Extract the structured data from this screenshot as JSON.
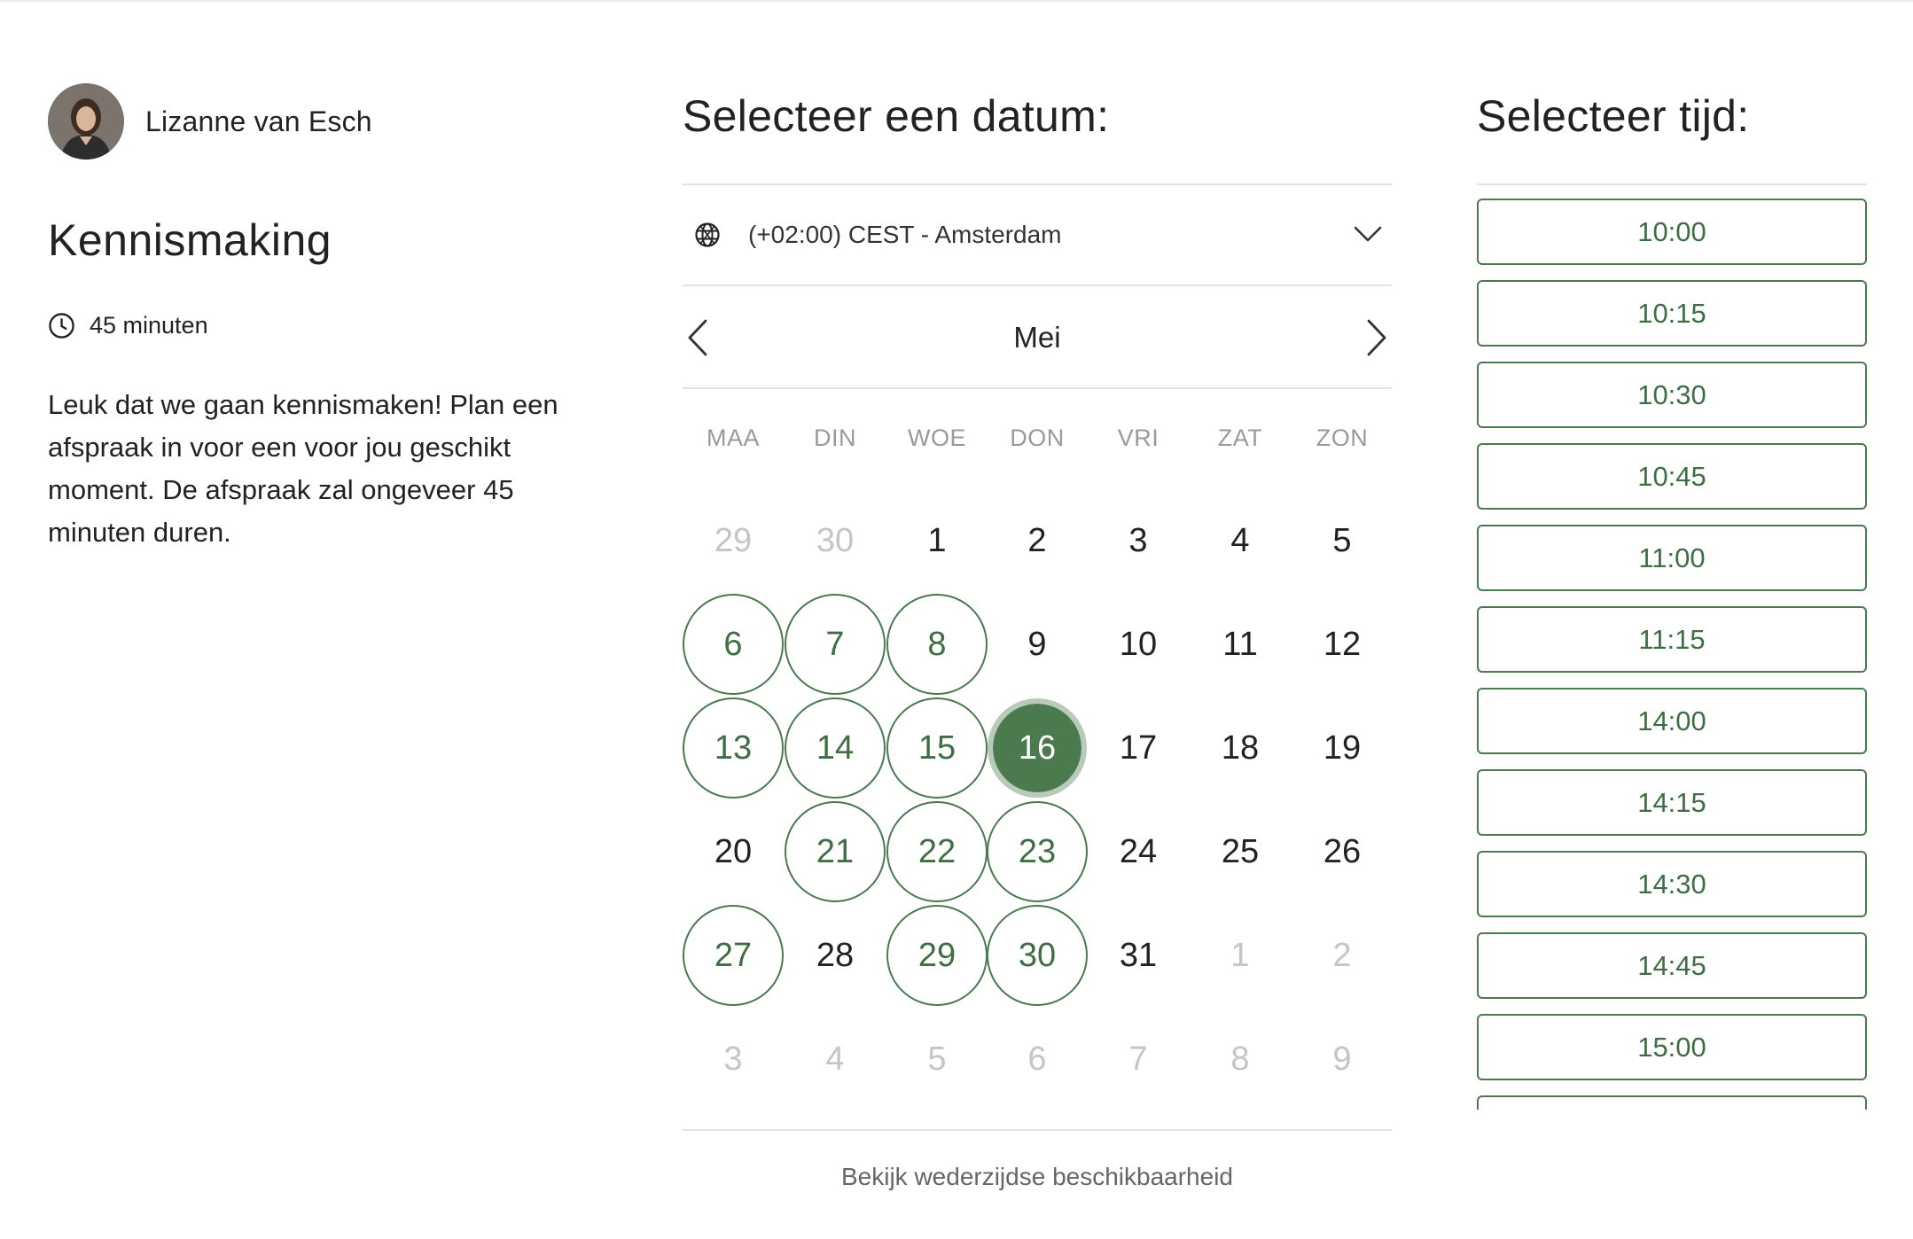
{
  "host": {
    "name": "Lizanne van Esch",
    "avatar_icon": "person-photo"
  },
  "event": {
    "title": "Kennismaking",
    "duration": "45 minuten",
    "description": "Leuk dat we gaan kennismaken! Plan een afspraak in voor een voor jou geschikt moment. De afspraak zal ongeveer 45 minuten duren."
  },
  "date_picker": {
    "heading": "Selecteer een datum:",
    "timezone": "(+02:00) CEST - Amsterdam",
    "month": "Mei",
    "weekdays": [
      "MAA",
      "DIN",
      "WOE",
      "DON",
      "VRI",
      "ZAT",
      "ZON"
    ],
    "weeks": [
      [
        {
          "d": "29",
          "s": "muted"
        },
        {
          "d": "30",
          "s": "muted"
        },
        {
          "d": "1",
          "s": "normal"
        },
        {
          "d": "2",
          "s": "normal"
        },
        {
          "d": "3",
          "s": "normal"
        },
        {
          "d": "4",
          "s": "normal"
        },
        {
          "d": "5",
          "s": "normal"
        }
      ],
      [
        {
          "d": "6",
          "s": "available"
        },
        {
          "d": "7",
          "s": "available"
        },
        {
          "d": "8",
          "s": "available"
        },
        {
          "d": "9",
          "s": "normal"
        },
        {
          "d": "10",
          "s": "normal"
        },
        {
          "d": "11",
          "s": "normal"
        },
        {
          "d": "12",
          "s": "normal"
        }
      ],
      [
        {
          "d": "13",
          "s": "available"
        },
        {
          "d": "14",
          "s": "available"
        },
        {
          "d": "15",
          "s": "available"
        },
        {
          "d": "16",
          "s": "selected"
        },
        {
          "d": "17",
          "s": "normal"
        },
        {
          "d": "18",
          "s": "normal"
        },
        {
          "d": "19",
          "s": "normal"
        }
      ],
      [
        {
          "d": "20",
          "s": "normal"
        },
        {
          "d": "21",
          "s": "available"
        },
        {
          "d": "22",
          "s": "available"
        },
        {
          "d": "23",
          "s": "available"
        },
        {
          "d": "24",
          "s": "normal"
        },
        {
          "d": "25",
          "s": "normal"
        },
        {
          "d": "26",
          "s": "normal"
        }
      ],
      [
        {
          "d": "27",
          "s": "available"
        },
        {
          "d": "28",
          "s": "normal"
        },
        {
          "d": "29",
          "s": "available"
        },
        {
          "d": "30",
          "s": "available"
        },
        {
          "d": "31",
          "s": "normal"
        },
        {
          "d": "1",
          "s": "muted"
        },
        {
          "d": "2",
          "s": "muted"
        }
      ],
      [
        {
          "d": "3",
          "s": "muted"
        },
        {
          "d": "4",
          "s": "muted"
        },
        {
          "d": "5",
          "s": "muted"
        },
        {
          "d": "6",
          "s": "muted"
        },
        {
          "d": "7",
          "s": "muted"
        },
        {
          "d": "8",
          "s": "muted"
        },
        {
          "d": "9",
          "s": "muted"
        }
      ]
    ],
    "selected_date": "16",
    "mutual_availability_link": "Bekijk wederzijdse beschikbaarheid"
  },
  "time_picker": {
    "heading": "Selecteer tijd:",
    "slots": [
      "10:00",
      "10:15",
      "10:30",
      "10:45",
      "11:00",
      "11:15",
      "14:00",
      "14:15",
      "14:30",
      "14:45",
      "15:00",
      ""
    ]
  },
  "colors": {
    "accent": "#4a7a4d",
    "accent_text": "#3f6e43",
    "selected_ring": "#b9c9ba",
    "muted": "#c5c5c5",
    "divider": "#e3e3e3"
  },
  "icons": {
    "clock": "clock-icon",
    "globe": "globe-icon",
    "dropdown": "chevron-down-icon",
    "prev": "chevron-left-icon",
    "next": "chevron-right-icon"
  }
}
